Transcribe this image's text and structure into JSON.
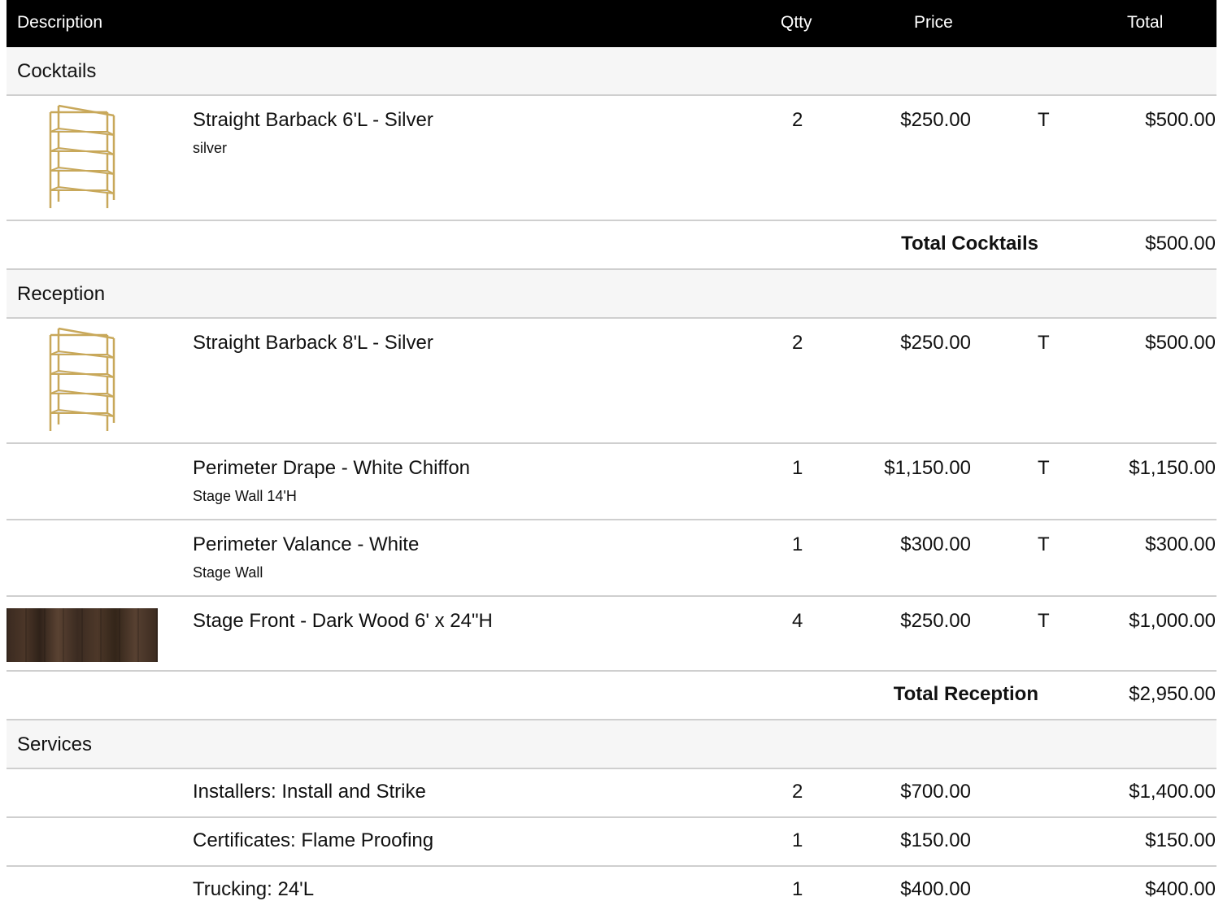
{
  "header": {
    "description": "Description",
    "qty": "Qtty",
    "price": "Price",
    "total": "Total"
  },
  "sections": [
    {
      "title": "Cocktails",
      "items": [
        {
          "name": "Straight Barback 6'L - Silver",
          "sub": "silver",
          "qty": "2",
          "price": "$250.00",
          "tax": "T",
          "total": "$500.00",
          "image": "barback-shelf-icon"
        }
      ],
      "total_label": "Total Cocktails",
      "total": "$500.00"
    },
    {
      "title": "Reception",
      "items": [
        {
          "name": "Straight Barback 8'L - Silver",
          "sub": "",
          "qty": "2",
          "price": "$250.00",
          "tax": "T",
          "total": "$500.00",
          "image": "barback-shelf-icon"
        },
        {
          "name": "Perimeter Drape - White Chiffon",
          "sub": "Stage Wall 14'H",
          "qty": "1",
          "price": "$1,150.00",
          "tax": "T",
          "total": "$1,150.00",
          "image": ""
        },
        {
          "name": "Perimeter Valance - White",
          "sub": "Stage Wall",
          "qty": "1",
          "price": "$300.00",
          "tax": "T",
          "total": "$300.00",
          "image": ""
        },
        {
          "name": "Stage Front - Dark Wood 6' x 24\"H",
          "sub": "",
          "qty": "4",
          "price": "$250.00",
          "tax": "T",
          "total": "$1,000.00",
          "image": "dark-wood-panel"
        }
      ],
      "total_label": "Total Reception",
      "total": "$2,950.00"
    },
    {
      "title": "Services",
      "items": [
        {
          "name": "Installers: Install and Strike",
          "qty": "2",
          "price": "$700.00",
          "total": "$1,400.00"
        },
        {
          "name": "Certificates: Flame Proofing",
          "qty": "1",
          "price": "$150.00",
          "total": "$150.00"
        },
        {
          "name": "Trucking: 24'L",
          "qty": "1",
          "price": "$400.00",
          "total": "$400.00"
        }
      ]
    }
  ]
}
